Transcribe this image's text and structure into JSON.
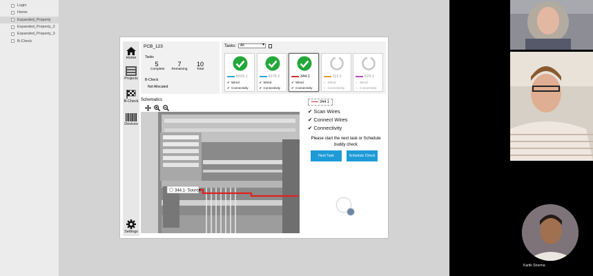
{
  "file_panel": {
    "items": [
      "Login",
      "Home",
      "Expanded_Property",
      "Expanded_Property_2",
      "Expanded_Property_3",
      "B-Check"
    ]
  },
  "sidebar": {
    "home": "Home",
    "projects": "Projects",
    "bcheck": "B-Check",
    "devices": "Devices",
    "settings": "Settings"
  },
  "summary": {
    "title": "PCB_123",
    "tasks_label": "Tasks",
    "complete_value": "5",
    "complete_label": "Complete",
    "remaining_value": "7",
    "remaining_label": "Remaining",
    "total_value": "10",
    "total_label": "Total",
    "bcheck_label": "B-Check",
    "allocation": "Not Allocated"
  },
  "tasks": {
    "label": "Tasks:",
    "filter": "All",
    "cards": [
      {
        "value": "6029.1",
        "color": "#29a8d6",
        "done": true,
        "wired": "Wired",
        "connectivity": "Connectivity"
      },
      {
        "value": "4378.2",
        "color": "#29a8d6",
        "done": true,
        "wired": "Wired",
        "connectivity": "Connectivity"
      },
      {
        "value": "344.1",
        "color": "#d32f2f",
        "done": true,
        "wired": "Wired",
        "connectivity": "Connectivity"
      },
      {
        "value": "112.1",
        "color": "#e59a2e",
        "done": false,
        "wired": "Wired",
        "connectivity": "Connectivity"
      },
      {
        "value": "629.1",
        "color": "#b04fc2",
        "done": false,
        "wired": "Wired",
        "connectivity": "Connectivity"
      }
    ]
  },
  "schematics": {
    "label": "Schematics",
    "source_label": "344.1- Source"
  },
  "status": {
    "tag": "344.1",
    "steps": [
      "Scan Wires",
      "Connect Wires",
      "Connectivity"
    ],
    "message": "Please start the next task or Schedule buddy check",
    "next_task": "Next Task",
    "schedule_check": "Schedule Check"
  },
  "participants": {
    "name3": "Kartik Sharma"
  },
  "colors": {
    "accent": "#1e9bd7",
    "success": "#22a83a",
    "wire_red": "#e02020"
  }
}
